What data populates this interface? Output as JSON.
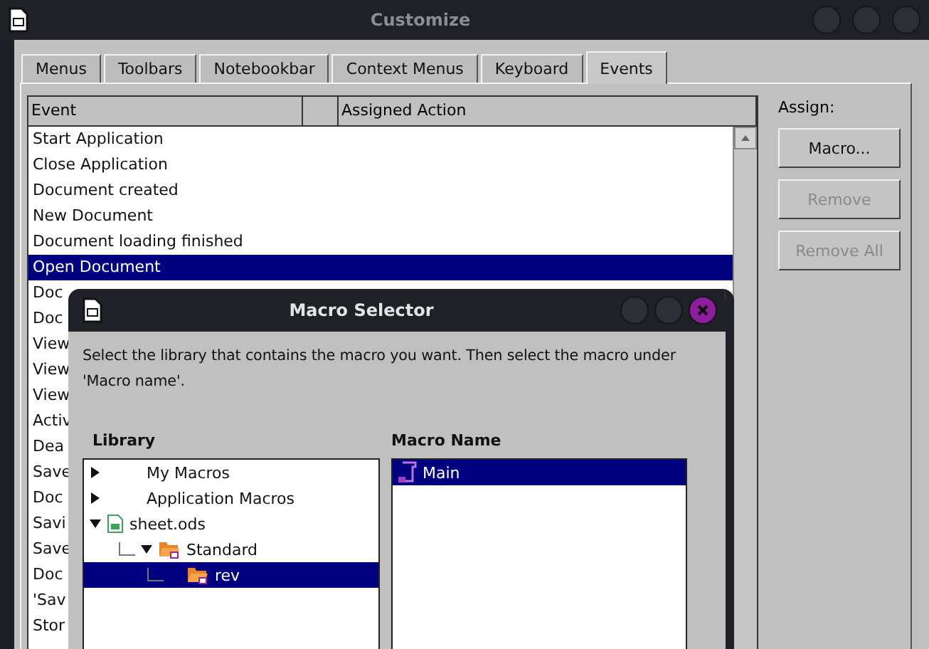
{
  "window": {
    "title": "Customize"
  },
  "tabs": [
    {
      "label": "Menus",
      "selected": false
    },
    {
      "label": "Toolbars",
      "selected": false
    },
    {
      "label": "Notebookbar",
      "selected": false
    },
    {
      "label": "Context Menus",
      "selected": false
    },
    {
      "label": "Keyboard",
      "selected": false
    },
    {
      "label": "Events",
      "selected": true
    }
  ],
  "events_table": {
    "columns": [
      "Event",
      "Assigned Action"
    ],
    "rows": [
      {
        "event": "Start Application",
        "selected": false
      },
      {
        "event": "Close Application",
        "selected": false
      },
      {
        "event": "Document created",
        "selected": false
      },
      {
        "event": "New Document",
        "selected": false
      },
      {
        "event": "Document loading finished",
        "selected": false
      },
      {
        "event": "Open Document",
        "selected": true
      },
      {
        "event": "Doc",
        "selected": false
      },
      {
        "event": "Doc",
        "selected": false
      },
      {
        "event": "View",
        "selected": false
      },
      {
        "event": "View",
        "selected": false
      },
      {
        "event": "View",
        "selected": false
      },
      {
        "event": "Activ",
        "selected": false
      },
      {
        "event": "Dea",
        "selected": false
      },
      {
        "event": "Save",
        "selected": false
      },
      {
        "event": "Doc",
        "selected": false
      },
      {
        "event": "Savi",
        "selected": false
      },
      {
        "event": "Save",
        "selected": false
      },
      {
        "event": "Doc",
        "selected": false
      },
      {
        "event": "'Sav",
        "selected": false
      },
      {
        "event": "Stor",
        "selected": false
      }
    ]
  },
  "assign": {
    "label": "Assign:",
    "buttons": [
      {
        "label": "Macro...",
        "disabled": false
      },
      {
        "label": "Remove",
        "disabled": true
      },
      {
        "label": "Remove All",
        "disabled": true
      }
    ]
  },
  "macro_selector": {
    "title": "Macro Selector",
    "description": "Select the library that contains the macro you want. Then select the macro under 'Macro name'.",
    "library_label": "Library",
    "library_tree": [
      {
        "label": "My Macros",
        "kind": "group",
        "expanded": false,
        "selected": false
      },
      {
        "label": "Application Macros",
        "kind": "group",
        "expanded": false,
        "selected": false
      },
      {
        "label": "sheet.ods",
        "kind": "document",
        "expanded": true,
        "selected": false,
        "children": [
          {
            "label": "Standard",
            "kind": "library",
            "expanded": true,
            "selected": false,
            "children": [
              {
                "label": "rev",
                "kind": "module",
                "selected": true
              }
            ]
          }
        ]
      }
    ],
    "macro_name_label": "Macro Name",
    "macros": [
      {
        "name": "Main",
        "selected": true
      }
    ]
  }
}
